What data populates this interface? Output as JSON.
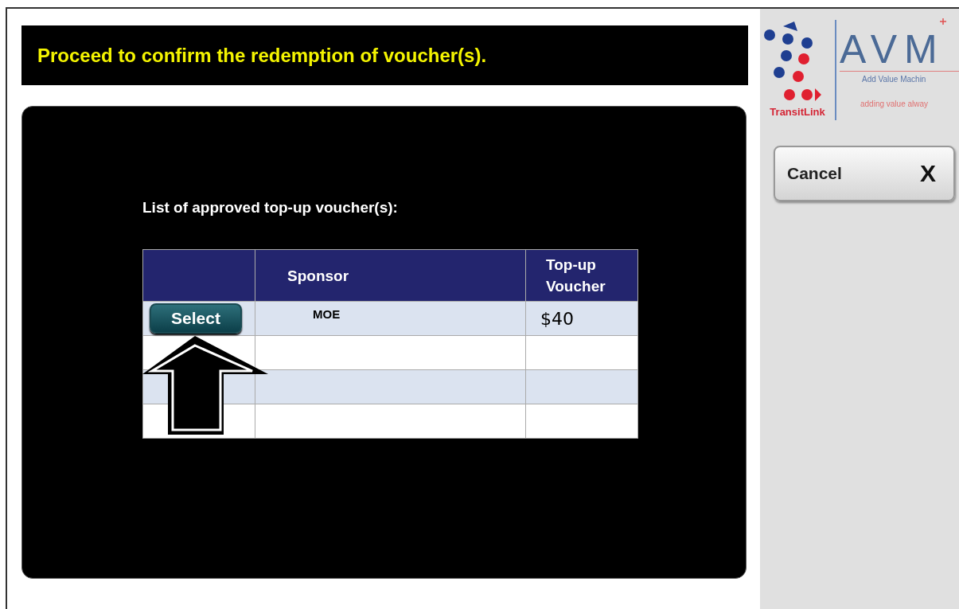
{
  "header": {
    "message": "Proceed to confirm the redemption of voucher(s)."
  },
  "list_title": "List of approved top-up voucher(s):",
  "table": {
    "columns": [
      {
        "label": "Sponsor"
      },
      {
        "label": "Top-up Voucher"
      }
    ],
    "rows": [
      {
        "kind": "voucher",
        "button": "Select",
        "sponsor": "MOE",
        "voucher": "$40"
      },
      {
        "kind": "empty"
      },
      {
        "kind": "empty"
      },
      {
        "kind": "empty"
      }
    ]
  },
  "logo": {
    "brand": "TransitLink",
    "product": "AVM",
    "subtitle": "Add Value Machin",
    "tagline": "adding value alway"
  },
  "cancel_button": {
    "label": "Cancel",
    "mark": "X"
  }
}
